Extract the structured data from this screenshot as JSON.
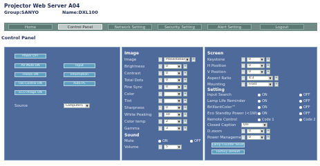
{
  "header": {
    "title": "Projector Web Server A04",
    "group_label": "Group:SANYO",
    "name_label": "Name:DXL100"
  },
  "nav": [
    "Home",
    "Control Panel",
    "Network Setting",
    "Security Setting",
    "Alert Setting",
    "Logout"
  ],
  "page_title": "Control Panel",
  "left": {
    "power_off": "Power OFF",
    "buttons": [
      "AV Mute ON",
      "Input",
      "Freeze ON",
      "Information",
      "Fan Control ON",
      "Auto PC",
      "ECO Image ON"
    ],
    "source_label": "Source",
    "source_value": "Computer1"
  },
  "image": {
    "header": "Image",
    "rows": [
      {
        "label": "Image",
        "value": "Presentation"
      },
      {
        "label": "Brightness",
        "value": "0"
      },
      {
        "label": "Contrast",
        "value": "0"
      },
      {
        "label": "Total Dots",
        "value": "0"
      },
      {
        "label": "Fine Sync",
        "value": "0"
      },
      {
        "label": "Color",
        "value": ""
      },
      {
        "label": "Tint",
        "value": ""
      },
      {
        "label": "Sharpness",
        "value": "0"
      },
      {
        "label": "White Peaking",
        "value": "10"
      },
      {
        "label": "Color temp",
        "value": "2"
      },
      {
        "label": "Gamma",
        "value": "3"
      }
    ],
    "sound_header": "Sound",
    "mute_label": "Mute",
    "mute_on": "ON",
    "mute_off": "OFF",
    "volume_label": "Volume",
    "volume_value": "5"
  },
  "screen": {
    "header": "Screen",
    "rows": [
      {
        "label": "Keystone",
        "value": "0"
      },
      {
        "label": "H Position",
        "value": "0"
      },
      {
        "label": "V Position",
        "value": "0"
      },
      {
        "label": "Aspect Ratio",
        "value": "4:3"
      },
      {
        "label": "Mounting",
        "value": "Front"
      }
    ],
    "setting_header": "Setting",
    "radios": [
      {
        "label": "Input Search",
        "a": "ON",
        "b": "OFF"
      },
      {
        "label": "Lamp Life Reminder",
        "a": "ON",
        "b": "OFF"
      },
      {
        "label": "BrilliantColor™",
        "a": "ON",
        "b": "OFF"
      },
      {
        "label": "Eco Standby Power (<1W)",
        "a": "ON",
        "b": "OFF"
      },
      {
        "label": "Remote Control",
        "a": "Code 1",
        "b": "Code 2"
      }
    ],
    "closed_caption_label": "Closed Caption",
    "closed_caption_value": "OFF",
    "dzoom_label": "D.zoom",
    "dzoom_value": "0",
    "power_mgmt_label": "Power Management",
    "power_mgmt_value": "0",
    "lamp_reset": "Lamp Counter Reset",
    "factory_default": "Factory Default"
  }
}
